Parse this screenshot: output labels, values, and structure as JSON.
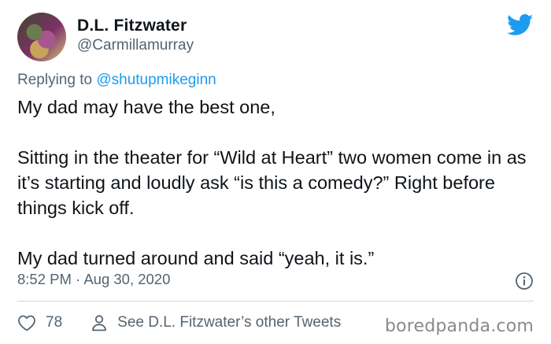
{
  "author": {
    "name": "D.L. Fitzwater",
    "handle": "@Carmillamurray"
  },
  "reply": {
    "prefix": "Replying to ",
    "mention": "@shutupmikeginn"
  },
  "tweet": {
    "p1": "My dad may have the best one,",
    "p2": "Sitting in the theater for “Wild at Heart” two women come in as it’s starting and loudly ask “is this a comedy?” Right before things kick off.",
    "p3": "My dad turned around and said “yeah, it is.”"
  },
  "meta": {
    "timestamp": "8:52 PM · Aug 30, 2020"
  },
  "actions": {
    "likes": "78",
    "other_tweets": "See D.L. Fitzwater’s other Tweets"
  },
  "watermark": "boredpanda.com",
  "colors": {
    "twitter_blue": "#1d9bf0",
    "secondary_text": "#536471"
  },
  "icons": {
    "brand": "twitter-bird-icon",
    "info": "info-icon",
    "like": "heart-icon",
    "profile": "person-icon"
  }
}
